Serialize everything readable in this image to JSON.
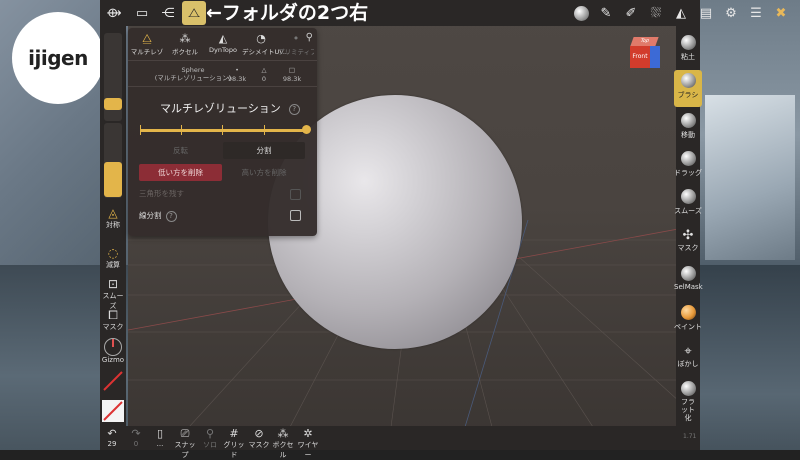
{
  "annotation": "←フォルダの2つ右",
  "logo": {
    "text": "ijigen"
  },
  "panel": {
    "tabs": [
      {
        "label": "マルチレゾ",
        "icon": "grid-pyramid-icon"
      },
      {
        "label": "ボクセル",
        "icon": "voxel-icon"
      },
      {
        "label": "DynTopo",
        "icon": "dyntopo-icon"
      },
      {
        "label": "デシメイトUV...",
        "icon": "decimate-icon"
      },
      {
        "label": "プリミティブ",
        "icon": "primitive-icon"
      }
    ],
    "mesh_name": "Sphere",
    "mesh_sub": "(マルチレゾリューション)",
    "stats": [
      {
        "icon": "•",
        "value": "98.3k"
      },
      {
        "icon": "△",
        "value": "0"
      },
      {
        "icon": "□",
        "value": "98.3k"
      }
    ],
    "title": "マルチレゾリューション",
    "help": "?",
    "btn_reverse": "反転",
    "btn_subdivide": "分割",
    "btn_delete_lower": "低い方を削除",
    "btn_delete_higher": "高い方を削除",
    "keep_triangles": "三角形を残す",
    "linear_subdivision": "線分割",
    "resolution_level": 1.0
  },
  "left_bar": {
    "symmetry": "対称",
    "subtract": "減算",
    "smooth": "スムーズ",
    "mask": "マスク",
    "gizmo": "Gizmo"
  },
  "bottom_bar": {
    "undo_count": "29",
    "redo_count": "0",
    "items": [
      "スナップ",
      "ソロ",
      "グリッド",
      "マスク",
      "ボクセル",
      "ワイヤー"
    ]
  },
  "right_bar": [
    {
      "label": "粘土",
      "icon": "clay-brush-icon"
    },
    {
      "label": "ブラシ",
      "icon": "brush-icon",
      "active": true
    },
    {
      "label": "移動",
      "icon": "move-icon"
    },
    {
      "label": "ドラッグ",
      "icon": "drag-icon"
    },
    {
      "label": "スムーズ",
      "icon": "smooth-icon"
    },
    {
      "label": "マスク",
      "icon": "mask-icon"
    },
    {
      "label": "SelMask",
      "icon": "selmask-icon"
    },
    {
      "label": "ペイント",
      "icon": "paint-icon"
    },
    {
      "label": "ぼかし",
      "icon": "blur-icon"
    },
    {
      "label": "フラット化",
      "icon": "flatten-icon"
    }
  ],
  "cube": {
    "top": "Top",
    "front": "Front"
  },
  "corner": "1.71",
  "colors": {
    "accent": "#e3b54a",
    "danger": "#8c2d36"
  }
}
